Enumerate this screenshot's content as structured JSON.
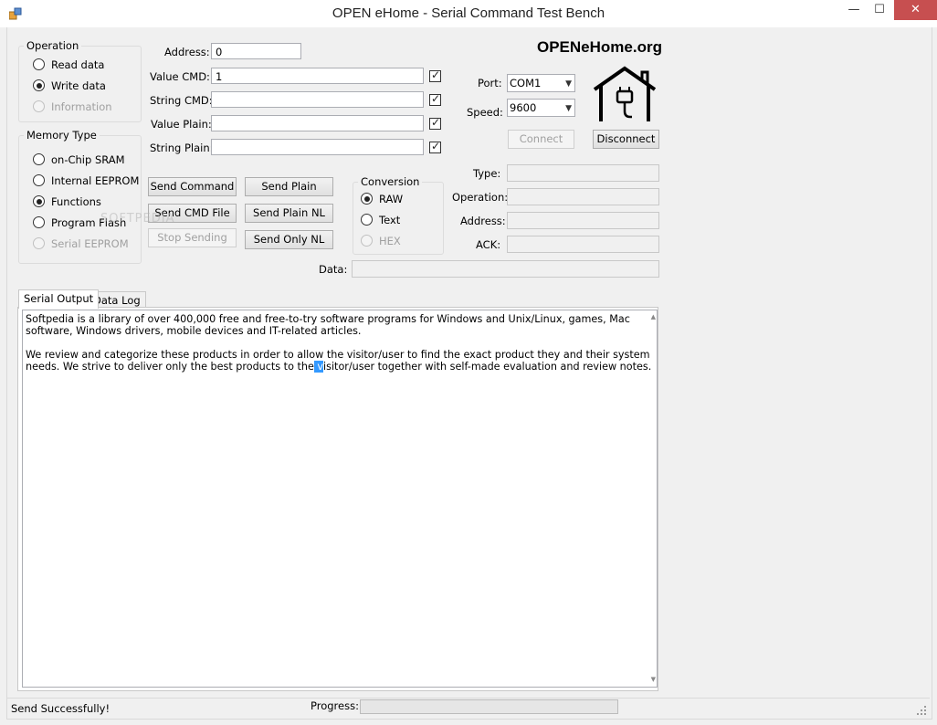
{
  "window": {
    "title": "OPEN eHome - Serial Command Test Bench",
    "minimize_glyph": "—",
    "maximize_glyph": "☐",
    "close_glyph": "✕"
  },
  "operation_group": {
    "label": "Operation",
    "options": [
      {
        "label": "Read data",
        "checked": false,
        "enabled": true
      },
      {
        "label": "Write data",
        "checked": true,
        "enabled": true
      },
      {
        "label": "Information",
        "checked": false,
        "enabled": false
      }
    ]
  },
  "memory_group": {
    "label": "Memory Type",
    "options": [
      {
        "label": "on-Chip SRAM",
        "checked": false,
        "enabled": true
      },
      {
        "label": "Internal EEPROM",
        "checked": false,
        "enabled": true
      },
      {
        "label": "Functions",
        "checked": true,
        "enabled": true
      },
      {
        "label": "Program Flash",
        "checked": false,
        "enabled": true
      },
      {
        "label": "Serial EEPROM",
        "checked": false,
        "enabled": false
      }
    ]
  },
  "fields": {
    "address_label": "Address:",
    "address_value": "0",
    "value_cmd_label": "Value CMD:",
    "value_cmd_value": "1",
    "string_cmd_label": "String CMD:",
    "string_cmd_value": "",
    "value_plain_label": "Value Plain:",
    "value_plain_value": "",
    "string_plain_label": "String Plain:",
    "string_plain_value": ""
  },
  "buttons": {
    "send_command": "Send Command",
    "send_plain": "Send Plain",
    "send_cmd_file": "Send CMD File",
    "send_plain_nl": "Send Plain NL",
    "stop_sending": "Stop Sending",
    "send_only_nl": "Send Only NL",
    "connect": "Connect",
    "disconnect": "Disconnect"
  },
  "conversion_group": {
    "label": "Conversion",
    "options": [
      {
        "label": "RAW",
        "checked": true,
        "enabled": true
      },
      {
        "label": "Text",
        "checked": false,
        "enabled": true
      },
      {
        "label": "HEX",
        "checked": false,
        "enabled": false
      }
    ]
  },
  "connection": {
    "brand": "OPENeHome.org",
    "port_label": "Port:",
    "port_value": "COM1",
    "speed_label": "Speed:",
    "speed_value": "9600"
  },
  "response": {
    "type_label": "Type:",
    "operation_label": "Operation:",
    "address_label": "Address:",
    "ack_label": "ACK:",
    "data_label": "Data:"
  },
  "tabs": [
    {
      "label": "Serial Output",
      "active": true
    },
    {
      "label": "Data Log",
      "active": false
    }
  ],
  "serial_output": {
    "para1": "Softpedia is a library of over 400,000 free and free-to-try software programs for Windows and Unix/Linux, games, Mac software, Windows drivers, mobile devices and IT-related articles.",
    "para2_before": "We review and categorize these products in order to allow the visitor/user to find the exact product they and their system needs. We strive to deliver only the best products to the",
    "para2_selected": " v",
    "para2_after": "isitor/user together with self-made evaluation and review notes."
  },
  "status": {
    "message": "Send Successfully!",
    "progress_label": "Progress:",
    "progress_value": 0
  },
  "watermark": {
    "text": "SOFTPEDIA"
  }
}
